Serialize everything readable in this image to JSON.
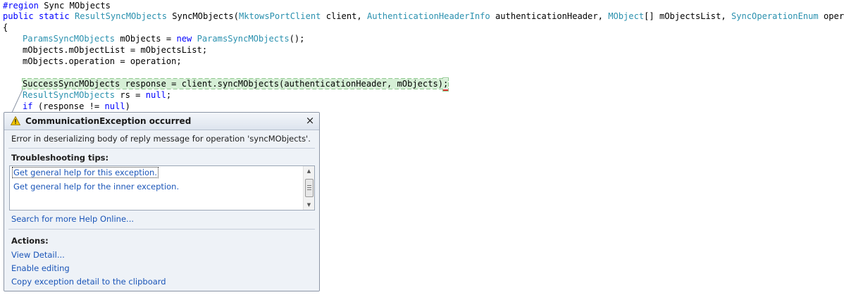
{
  "editor": {
    "line1": {
      "region_kw": "#region",
      "region_name": " Sync MObjects"
    },
    "line2": {
      "kw_public": "public",
      "kw_static": "static",
      "t_result": "ResultSyncMObjects",
      "method": "SyncMObjects(",
      "t_client": "MktowsPortClient",
      "p_client": " client, ",
      "t_auth": "AuthenticationHeaderInfo",
      "p_auth": " authenticationHeader, ",
      "t_mobject": "MObject",
      "p_list": "[] mObjectsList, ",
      "t_enum": "SyncOperationEnum",
      "p_op": " operation)"
    },
    "line3": "{",
    "line4": {
      "t_params": "ParamsSyncMObjects",
      "text1": " mObjects = ",
      "kw_new": "new",
      "t_params2": "ParamsSyncMObjects",
      "text2": "();"
    },
    "line5": "mObjects.mObjectList = mObjectsList;",
    "line6": "mObjects.operation = operation;",
    "line8": {
      "stmt": "SuccessSyncMObjects response = client.syncMObjects(authenticationHeader, mObjects)",
      "semicolon": ";"
    },
    "line9": {
      "t_result": "ResultSyncMObjects",
      "text1": " rs = ",
      "kw_null": "null",
      "text2": ";"
    },
    "line10": {
      "kw_if": "if",
      "text1": " (response != ",
      "kw_null": "null",
      "text2": ")"
    }
  },
  "popup": {
    "title": "CommunicationException occurred",
    "close_glyph": "×",
    "icon": "warning-icon",
    "message": "Error in deserializing body of reply message for operation 'syncMObjects'.",
    "tips_heading": "Troubleshooting tips:",
    "tips": [
      "Get general help for this exception.",
      "Get general help for the inner exception."
    ],
    "search_link": "Search for more Help Online...",
    "actions_heading": "Actions:",
    "actions": [
      "View Detail...",
      "Enable editing",
      "Copy exception detail to the clipboard"
    ]
  },
  "colors": {
    "keyword": "#0000ff",
    "type": "#2b91af",
    "link": "#1a55b8",
    "highlight": "#d6efd6"
  }
}
